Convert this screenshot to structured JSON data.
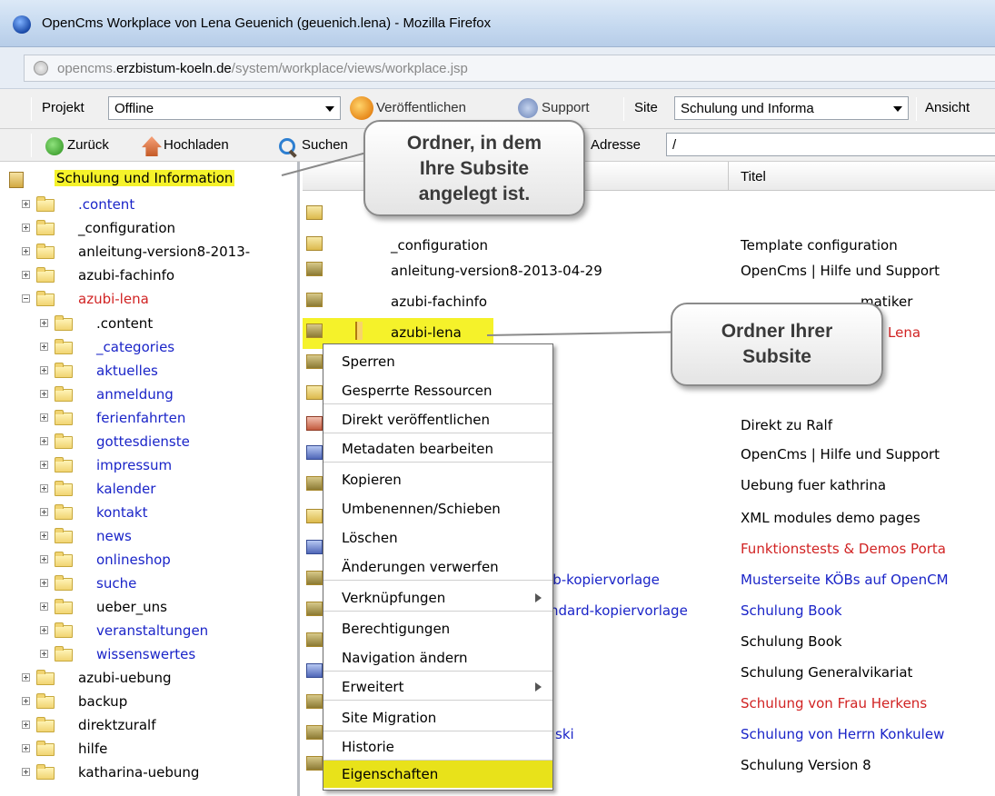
{
  "window": {
    "title": "OpenCms Workplace von Lena Geuenich (geuenich.lena) - Mozilla Firefox"
  },
  "address": {
    "host_prefix": "opencms.",
    "host_bold": "erzbistum-koeln.de",
    "path": "/system/workplace/views/workplace.jsp"
  },
  "toolbar1": {
    "projekt_label": "Projekt",
    "projekt_value": "Offline",
    "publish_label": "Veröffentlichen",
    "help_label": "Support",
    "site_label": "Site",
    "site_value": "Schulung und Informa",
    "ansicht_label": "Ansicht"
  },
  "toolbar2": {
    "back_label": "Zurück",
    "upload_label": "Hochladen",
    "search_label": "Suchen",
    "address_label": "Adresse",
    "address_value": "/"
  },
  "tree": {
    "root": "Schulung und Information",
    "items": [
      {
        "label": ".content",
        "color": "blue"
      },
      {
        "label": "_configuration",
        "color": "black"
      },
      {
        "label": "anleitung-version8-2013-",
        "color": "black"
      },
      {
        "label": "azubi-fachinfo",
        "color": "black"
      },
      {
        "label": "azubi-lena",
        "color": "red"
      },
      {
        "label": ".content",
        "color": "black"
      },
      {
        "label": "_categories",
        "color": "blue"
      },
      {
        "label": "aktuelles",
        "color": "blue"
      },
      {
        "label": "anmeldung",
        "color": "blue"
      },
      {
        "label": "ferienfahrten",
        "color": "blue"
      },
      {
        "label": "gottesdienste",
        "color": "blue"
      },
      {
        "label": "impressum",
        "color": "blue"
      },
      {
        "label": "kalender",
        "color": "blue"
      },
      {
        "label": "kontakt",
        "color": "blue"
      },
      {
        "label": "news",
        "color": "blue"
      },
      {
        "label": "onlineshop",
        "color": "blue"
      },
      {
        "label": "suche",
        "color": "blue"
      },
      {
        "label": "ueber_uns",
        "color": "black"
      },
      {
        "label": "veranstaltungen",
        "color": "blue"
      },
      {
        "label": "wissenswertes",
        "color": "blue"
      },
      {
        "label": "azubi-uebung",
        "color": "black"
      },
      {
        "label": "backup",
        "color": "black"
      },
      {
        "label": "direktzuralf",
        "color": "black"
      },
      {
        "label": "hilfe",
        "color": "black"
      },
      {
        "label": "katharina-uebung",
        "color": "black"
      }
    ]
  },
  "list": {
    "header_title": "Titel",
    "rows": [
      {
        "name": "",
        "title": "",
        "title_color": "black"
      },
      {
        "name": "_configuration",
        "title": "Template configuration",
        "title_color": "black"
      },
      {
        "name": "anleitung-version8-2013-04-29",
        "title": "OpenCms | Hilfe und Support",
        "title_color": "black"
      },
      {
        "name": "azubi-fachinfo",
        "title": "matiker",
        "title_color": "black"
      },
      {
        "name": "azubi-lena",
        "title": "Lena",
        "title_color": "red"
      },
      {
        "name": "",
        "title": "",
        "title_color": "black"
      },
      {
        "name": "",
        "title": "",
        "title_color": "black"
      },
      {
        "name": "",
        "title": "Direkt zu Ralf",
        "title_color": "black"
      },
      {
        "name": "",
        "title": "OpenCms | Hilfe und Support",
        "title_color": "black"
      },
      {
        "name": "",
        "title": "Uebung fuer kathrina",
        "title_color": "black"
      },
      {
        "name": "",
        "title": "XML modules demo pages",
        "title_color": "black"
      },
      {
        "name": "",
        "title": "Funktionstests & Demos Porta",
        "title_color": "red"
      },
      {
        "name": "eb-kopiervorlage",
        "title": "Musterseite KÖBs auf OpenCM",
        "title_color": "blue"
      },
      {
        "name": "ndard-kopiervorlage",
        "title": "Schulung Book",
        "title_color": "blue"
      },
      {
        "name": "",
        "title": "Schulung Book",
        "title_color": "black"
      },
      {
        "name": "",
        "title": "Schulung Generalvikariat",
        "title_color": "black"
      },
      {
        "name": "",
        "title": "Schulung von Frau Herkens",
        "title_color": "red"
      },
      {
        "name": "ski",
        "title": "Schulung von Herrn Konkulew",
        "title_color": "blue"
      },
      {
        "name": "",
        "title": "Schulung Version 8",
        "title_color": "black"
      }
    ]
  },
  "context_menu": [
    {
      "label": "Sperren"
    },
    {
      "label": "Gesperrte Ressourcen"
    },
    {
      "label": "Direkt veröffentlichen"
    },
    {
      "label": "Metadaten bearbeiten"
    },
    {
      "label": "Kopieren"
    },
    {
      "label": "Umbenennen/Schieben"
    },
    {
      "label": "Löschen"
    },
    {
      "label": "Änderungen verwerfen"
    },
    {
      "label": "Verknüpfungen"
    },
    {
      "label": "Berechtigungen"
    },
    {
      "label": "Navigation ändern"
    },
    {
      "label": "Erweitert"
    },
    {
      "label": "Site Migration"
    },
    {
      "label": "Historie"
    },
    {
      "label": "Eigenschaften"
    }
  ],
  "callouts": {
    "folder_callout_line1": "Ordner, in dem",
    "folder_callout_line2": "Ihre Subsite",
    "folder_callout_line3": "angelegt ist.",
    "subsite_callout_line1": "Ordner Ihrer",
    "subsite_callout_line2": "Subsite"
  },
  "colors": {
    "highlight": "#f5f22a",
    "menu_active": "#e8e21a",
    "link_blue": "#1a24c8",
    "link_red": "#d12323"
  }
}
